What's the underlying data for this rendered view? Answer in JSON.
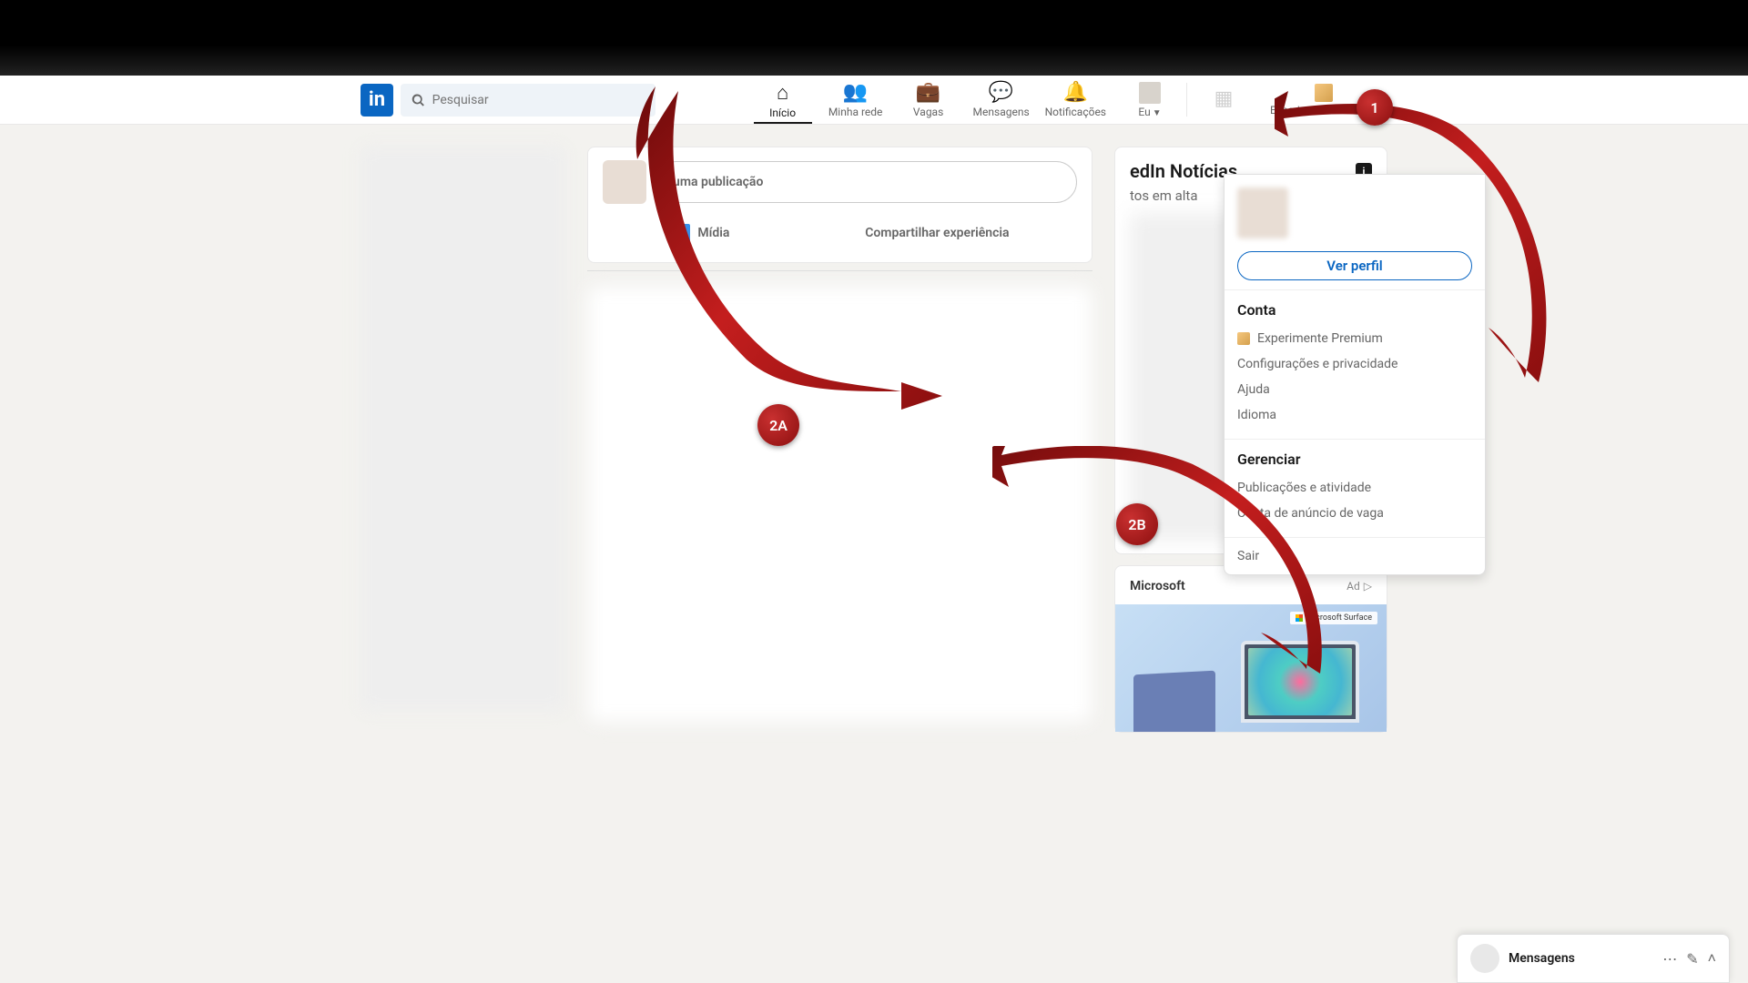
{
  "header": {
    "logo_text": "in",
    "search_placeholder": "Pesquisar",
    "nav": {
      "home": "Início",
      "network": "Minha rede",
      "jobs": "Vagas",
      "messaging": "Mensagens",
      "notifications": "Notificações",
      "me": "Eu",
      "premium": "Experimente Premium"
    }
  },
  "compose": {
    "placeholder": "uma publicação",
    "media": "Mídia",
    "share_exp": "Compartilhar experiência"
  },
  "news": {
    "title": "edIn Notícias",
    "subtitle": "tos em alta"
  },
  "ad": {
    "brand": "Microsoft",
    "label": "Ad",
    "badge": "Microsoft Surface"
  },
  "dropdown": {
    "view_profile": "Ver perfil",
    "section_account": "Conta",
    "premium": "Experimente Premium",
    "settings": "Configurações e privacidade",
    "help": "Ajuda",
    "language": "Idioma",
    "section_manage": "Gerenciar",
    "posts_activity": "Publicações e atividade",
    "job_account": "Conta de anúncio de vaga",
    "signout": "Sair"
  },
  "messaging": {
    "title": "Mensagens"
  },
  "annotations": {
    "step1": "1",
    "step2a": "2A",
    "step2b": "2B"
  }
}
